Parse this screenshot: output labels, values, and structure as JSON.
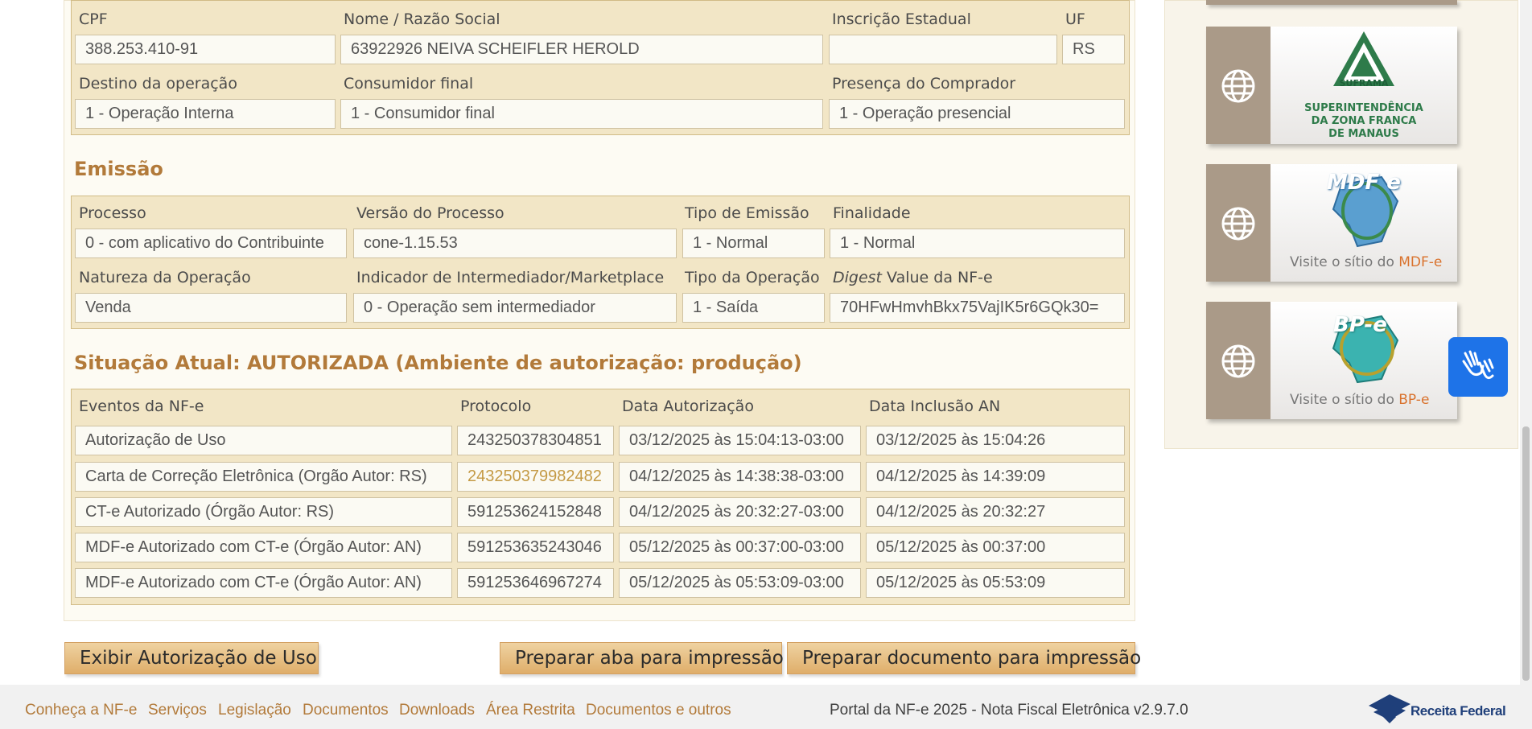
{
  "destinatario": {
    "cpf_label": "CPF",
    "cpf": "388.253.410-91",
    "nome_label": "Nome / Razão Social",
    "nome": "63922926 NEIVA SCHEIFLER HEROLD",
    "ie_label": "Inscrição Estadual",
    "ie": "",
    "uf_label": "UF",
    "uf": "RS",
    "destino_label": "Destino da operação",
    "destino": "1 - Operação Interna",
    "consumidor_label": "Consumidor final",
    "consumidor": "1 - Consumidor final",
    "presenca_label": "Presença do Comprador",
    "presenca": "1 - Operação presencial"
  },
  "emissao": {
    "title": "Emissão",
    "processo_label": "Processo",
    "processo": "0 - com aplicativo do Contribuinte",
    "versao_label": "Versão do Processo",
    "versao": "cone-1.15.53",
    "tipo_emissao_label": "Tipo de Emissão",
    "tipo_emissao": "1 - Normal",
    "finalidade_label": "Finalidade",
    "finalidade": "1 - Normal",
    "natureza_label": "Natureza da Operação",
    "natureza": "Venda",
    "indicador_label": "Indicador de Intermediador/Marketplace",
    "indicador": "0 - Operação sem intermediador",
    "tipo_operacao_label": "Tipo da Operação",
    "tipo_operacao": "1 - Saída",
    "digest_label_italic": "Digest",
    "digest_label_rest": " Value da NF-e",
    "digest": "70HFwHmvhBkx75VajIK5r6GQk30="
  },
  "situacao": {
    "title": "Situação Atual: AUTORIZADA (Ambiente de autorização: produção)",
    "headers": [
      "Eventos da NF-e",
      "Protocolo",
      "Data Autorização",
      "Data Inclusão AN"
    ],
    "rows": [
      {
        "evento": "Autorização de Uso",
        "protocolo": "243250378304851",
        "data_aut": "03/12/2025 às 15:04:13-03:00",
        "data_an": "03/12/2025 às 15:04:26"
      },
      {
        "evento": "Carta de Correção Eletrônica (Orgão Autor: RS)",
        "protocolo": "243250379982482",
        "data_aut": "04/12/2025 às 14:38:38-03:00",
        "data_an": "04/12/2025 às 14:39:09"
      },
      {
        "evento": "CT-e Autorizado (Órgão Autor: RS)",
        "protocolo": "591253624152848",
        "data_aut": "04/12/2025 às 20:32:27-03:00",
        "data_an": "04/12/2025 às 20:32:27"
      },
      {
        "evento": "MDF-e Autorizado com CT-e (Órgão Autor: AN)",
        "protocolo": "591253635243046",
        "data_aut": "05/12/2025 às 00:37:00-03:00",
        "data_an": "05/12/2025 às 00:37:00"
      },
      {
        "evento": "MDF-e Autorizado com CT-e (Órgão Autor: AN)",
        "protocolo": "591253646967274",
        "data_aut": "05/12/2025 às 05:53:09-03:00",
        "data_an": "05/12/2025 às 05:53:09"
      }
    ]
  },
  "buttons": {
    "exibir": "Exibir Autorização de Uso",
    "preparar_aba": "Preparar aba para impressão",
    "preparar_doc": "Preparar documento para impressão"
  },
  "sidebar": {
    "suframa_name": "SUFRAMA",
    "suframa_line1": "SUPERINTENDÊNCIA",
    "suframa_line2": "DA ZONA FRANCA",
    "suframa_line3": "DE MANAUS",
    "mdfe_logo": "MDF e",
    "mdfe_visite_prefix": "Visite o sítio do ",
    "mdfe_visite_name": "MDF-e",
    "bpe_logo": "BP-e",
    "bpe_visite_prefix": "Visite o sítio do ",
    "bpe_visite_name": "BP-e",
    "icons": [
      "globe-icon",
      "globe-icon",
      "globe-icon",
      "sign-language-icon"
    ]
  },
  "footer": {
    "links": [
      "Conheça a NF-e",
      "Serviços",
      "Legislação",
      "Documentos",
      "Downloads",
      "Área Restrita",
      "Documentos e outros"
    ],
    "portal_text": "Portal da NF-e 2025 - Nota Fiscal Eletrônica v2.9.7.0",
    "receita_logo_text": "Receita Federal"
  },
  "colors": {
    "section_title": "#b27a3a",
    "box_bg": "#f2e6c6",
    "link": "#b27a3a",
    "accessibility_button": "#1e73e8"
  }
}
